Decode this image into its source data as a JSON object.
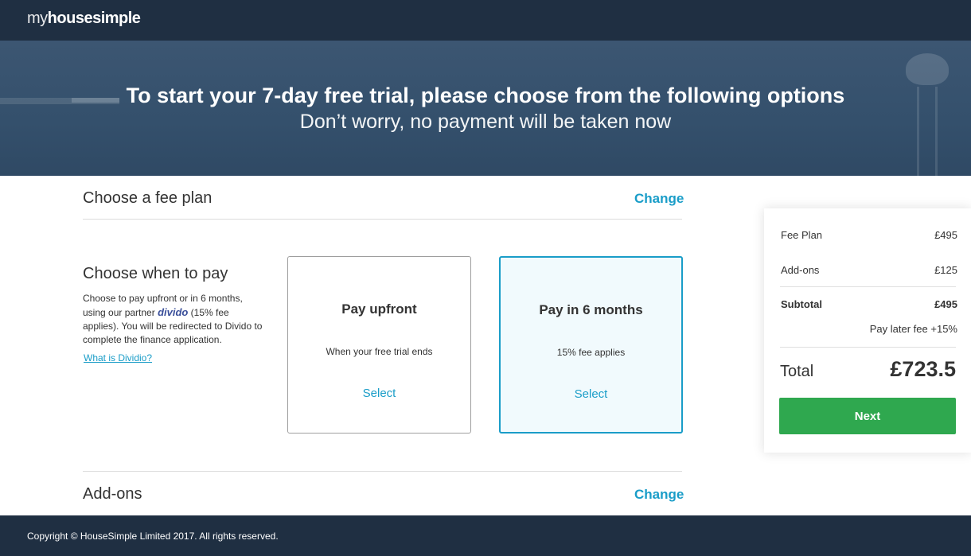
{
  "header": {
    "logo_thin": "my",
    "logo_bold": "housesimple"
  },
  "hero": {
    "title": "To start your 7-day free trial, please choose from the following options",
    "subtitle": "Don’t worry, no payment will be taken now"
  },
  "fee_plan": {
    "title": "Choose a fee plan",
    "change_label": "Change"
  },
  "when_to_pay": {
    "title": "Choose when to pay",
    "desc_before": "Choose to pay upfront or in 6 months, using our partner ",
    "brand": "divido",
    "desc_after": " (15% fee applies). You will be redirected to Divido to complete the finance application.",
    "link_label": "What is Dividio?"
  },
  "options": [
    {
      "title": "Pay upfront",
      "description": "When your free trial ends",
      "select_label": "Select",
      "selected": false
    },
    {
      "title": "Pay in 6 months",
      "description": "15% fee applies",
      "select_label": "Select",
      "selected": true
    }
  ],
  "addons": {
    "title": "Add-ons",
    "change_label": "Change"
  },
  "summary": {
    "fee_plan_label": "Fee Plan",
    "fee_plan_value": "£495",
    "addons_label": "Add-ons",
    "addons_value": "£125",
    "subtotal_label": "Subtotal",
    "subtotal_value": "£495",
    "pay_later_label": "Pay later fee",
    "pay_later_value": "+15%",
    "total_label": "Total",
    "total_value": "£723.5",
    "next_label": "Next"
  },
  "footer": {
    "copyright": "Copyright © HouseSimple Limited 2017. All rights reserved."
  },
  "colors": {
    "navy": "#1f2f42",
    "accent": "#1a9dc8",
    "next_green": "#2fa84f"
  }
}
